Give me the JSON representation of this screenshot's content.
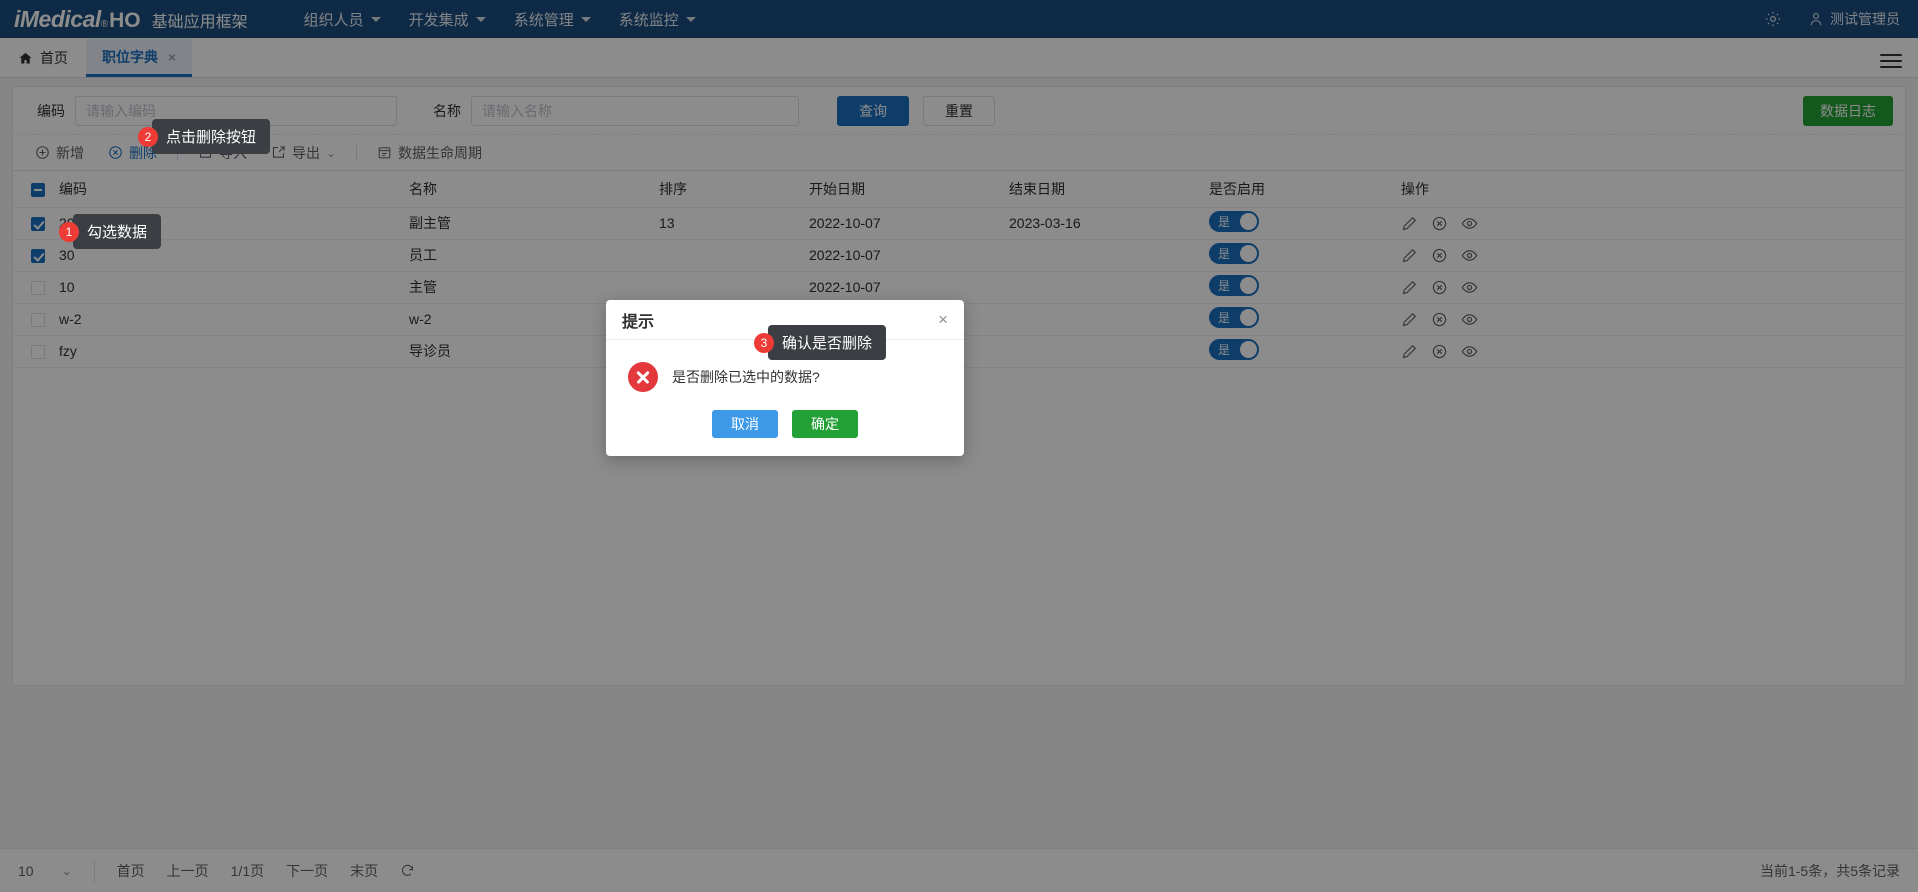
{
  "header": {
    "logo": "iMedical",
    "reg": "®",
    "ho": "HO",
    "subtitle": "基础应用框架",
    "nav": [
      {
        "label": "组织人员"
      },
      {
        "label": "开发集成"
      },
      {
        "label": "系统管理"
      },
      {
        "label": "系统监控"
      }
    ],
    "settings_icon": "gear-icon",
    "user_icon": "user-icon",
    "username": "测试管理员",
    "bg_color": "#1b4f82"
  },
  "tabs": {
    "home_label": "首页",
    "home_icon": "home-icon",
    "active_label": "职位字典",
    "close_glyph": "×",
    "menu_icon": "hamburger-icon"
  },
  "search": {
    "code_label": "编码",
    "code_placeholder": "请输入编码",
    "code_value": "",
    "name_label": "名称",
    "name_placeholder": "请输入名称",
    "name_value": "",
    "query_label": "查询",
    "reset_label": "重置",
    "datalog_label": "数据日志",
    "primary_color": "#1b6fc0",
    "success_color": "#23a136"
  },
  "toolbar": {
    "add_label": "新增",
    "add_icon": "plus-circle-icon",
    "delete_label": "删除",
    "delete_icon": "close-circle-icon",
    "import_label": "导入",
    "import_icon": "import-icon",
    "export_label": "导出",
    "export_icon": "export-icon",
    "export_caret": "⌄",
    "lifecycle_label": "数据生命周期",
    "lifecycle_icon": "calendar-icon"
  },
  "table": {
    "headers": [
      "编码",
      "名称",
      "排序",
      "开始日期",
      "结束日期",
      "是否启用",
      "操作"
    ],
    "header_checkbox_state": "indeterminate",
    "enabled_label": "是",
    "row_icons": [
      "edit-icon",
      "disable-icon",
      "view-icon"
    ],
    "rows": [
      {
        "checked": true,
        "code": "20",
        "name": "副主管",
        "sort": "13",
        "start_date": "2022-10-07",
        "end_date": "2023-03-16",
        "enabled": "是"
      },
      {
        "checked": true,
        "code": "30",
        "name": "员工",
        "sort": "",
        "start_date": "2022-10-07",
        "end_date": "",
        "enabled": "是"
      },
      {
        "checked": false,
        "code": "10",
        "name": "主管",
        "sort": "",
        "start_date": "2022-10-07",
        "end_date": "",
        "enabled": "是"
      },
      {
        "checked": false,
        "code": "w-2",
        "name": "w-2",
        "sort": "",
        "start_date": "",
        "end_date": "",
        "enabled": "是"
      },
      {
        "checked": false,
        "code": "fzy",
        "name": "导诊员",
        "sort": "",
        "start_date": "",
        "end_date": "",
        "enabled": "是"
      }
    ]
  },
  "pager": {
    "page_size": "10",
    "page_size_caret": "⌄",
    "first": "首页",
    "prev": "上一页",
    "current": "1/1页",
    "next": "下一页",
    "last": "末页",
    "refresh_icon": "refresh-icon",
    "total_text": "当前1-5条，共5条记录"
  },
  "dialog": {
    "title": "提示",
    "close_glyph": "×",
    "icon": "error-x-icon",
    "message": "是否删除已选中的数据?",
    "cancel_label": "取消",
    "confirm_label": "确定",
    "cancel_color": "#3c9ae8",
    "confirm_color": "#23a136"
  },
  "coach_marks": [
    {
      "badge": "1",
      "text": "勾选数据"
    },
    {
      "badge": "2",
      "text": "点击删除按钮"
    },
    {
      "badge": "3",
      "text": "确认是否删除"
    }
  ]
}
